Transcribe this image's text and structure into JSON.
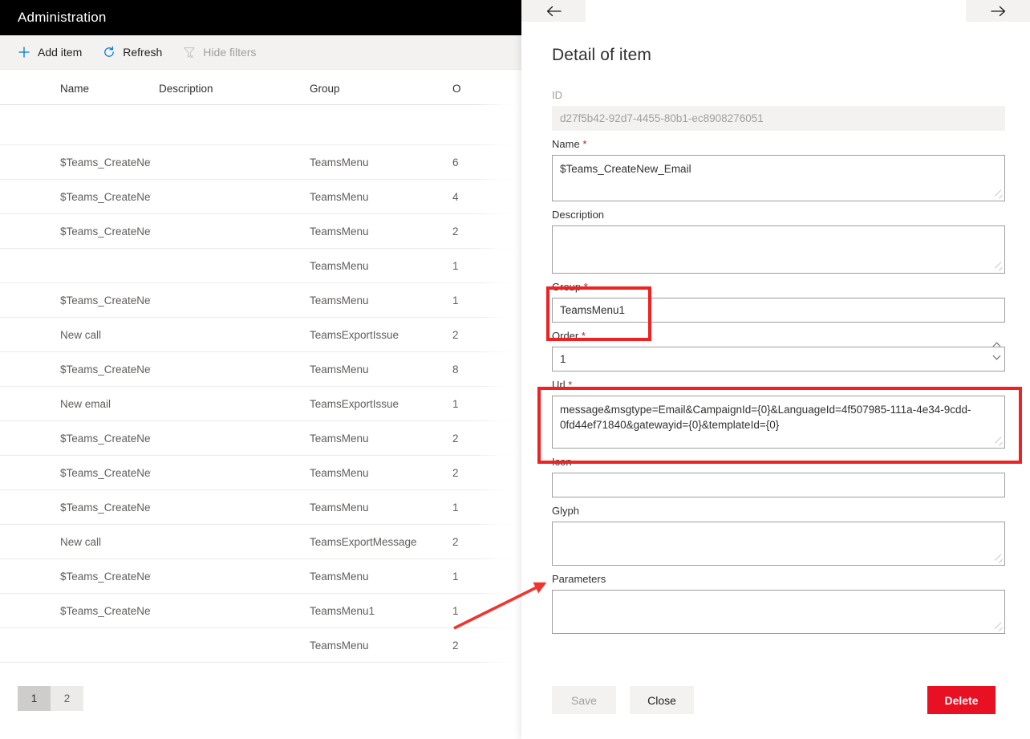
{
  "app": {
    "title": "Administration"
  },
  "command_bar": {
    "items": [
      {
        "label": "Add item",
        "icon": "plus-icon",
        "disabled": false
      },
      {
        "label": "Refresh",
        "icon": "refresh-icon",
        "disabled": false
      },
      {
        "label": "Hide filters",
        "icon": "filter-off-icon",
        "disabled": true
      }
    ]
  },
  "grid": {
    "columns": [
      "Name",
      "Description",
      "Group",
      "O"
    ],
    "rows": [
      {
        "name": "",
        "description": "",
        "group": "",
        "order": ""
      },
      {
        "name": "$Teams_CreateNew_Sms",
        "description": "",
        "group": "TeamsMenu",
        "order": "6"
      },
      {
        "name": "$Teams_CreateNew_Email",
        "description": "",
        "group": "TeamsMenu",
        "order": "4"
      },
      {
        "name": "$Teams_CreateNew_ClientAlert",
        "description": "",
        "group": "TeamsMenu",
        "order": "2"
      },
      {
        "name": "",
        "description": "",
        "group": "TeamsMenu",
        "order": "1"
      },
      {
        "name": "$Teams_CreateNew_Note",
        "description": "",
        "group": "TeamsMenu",
        "order": "1"
      },
      {
        "name": "New call",
        "description": "",
        "group": "TeamsExportIssue",
        "order": "2"
      },
      {
        "name": "$Teams_CreateNew_Fax",
        "description": "",
        "group": "TeamsMenu",
        "order": "8"
      },
      {
        "name": "New email",
        "description": "",
        "group": "TeamsExportIssue",
        "order": "1"
      },
      {
        "name": "$Teams_CreateNew_KbArticle",
        "description": "",
        "group": "TeamsMenu",
        "order": "2"
      },
      {
        "name": "$Teams_CreateNew_Outboun...",
        "description": "",
        "group": "TeamsMenu",
        "order": "2"
      },
      {
        "name": "$Teams_CreateNew_Issue",
        "description": "",
        "group": "TeamsMenu",
        "order": "1"
      },
      {
        "name": "New call",
        "description": "",
        "group": "TeamsExportMessage",
        "order": "2"
      },
      {
        "name": "$Teams_CreateNew_Task",
        "description": "",
        "group": "TeamsMenu",
        "order": "1"
      },
      {
        "name": "$Teams_CreateNew_Email",
        "description": "",
        "group": "TeamsMenu1",
        "order": "1"
      },
      {
        "name": "",
        "description": "",
        "group": "TeamsMenu",
        "order": "2"
      }
    ]
  },
  "pagination": {
    "pages": [
      "1",
      "2"
    ],
    "active": "1"
  },
  "panel": {
    "nav": {
      "prev_icon": "arrow-left-icon",
      "next_icon": "arrow-right-icon"
    },
    "title": "Detail of item",
    "fields": {
      "id": {
        "label": "ID",
        "value": "d27f5b42-92d7-4455-80b1-ec8908276051",
        "required": false,
        "readonly": true
      },
      "name": {
        "label": "Name",
        "value": "$Teams_CreateNew_Email",
        "required": true
      },
      "description": {
        "label": "Description",
        "value": "",
        "required": false
      },
      "group": {
        "label": "Group",
        "value": "TeamsMenu1",
        "required": true
      },
      "order": {
        "label": "Order",
        "value": "1",
        "required": true
      },
      "url": {
        "label": "Url",
        "value": "message&msgtype=Email&CampaignId={0}&LanguageId=4f507985-111a-4e34-9cdd-0fd44ef71840&gatewayid={0}&templateId={0}",
        "required": true
      },
      "icon": {
        "label": "Icon",
        "value": "",
        "required": false
      },
      "glyph": {
        "label": "Glyph",
        "value": "",
        "required": false
      },
      "parameters": {
        "label": "Parameters",
        "value": "",
        "required": false
      }
    },
    "footer": {
      "save_label": "Save",
      "close_label": "Close",
      "delete_label": "Delete"
    }
  },
  "annotations": {
    "highlight_color": "#ee2222",
    "boxes": [
      "group-field",
      "url-field"
    ],
    "arrow": "points from grid row $Teams_CreateNew_Email / TeamsMenu1 to the detail panel"
  },
  "colors": {
    "title_bar": "#000000",
    "command_bar": "#f3f2f1",
    "accent": "#0078d4",
    "delete": "#e81123",
    "required": "#a4262c",
    "annotation": "#ee2222"
  }
}
